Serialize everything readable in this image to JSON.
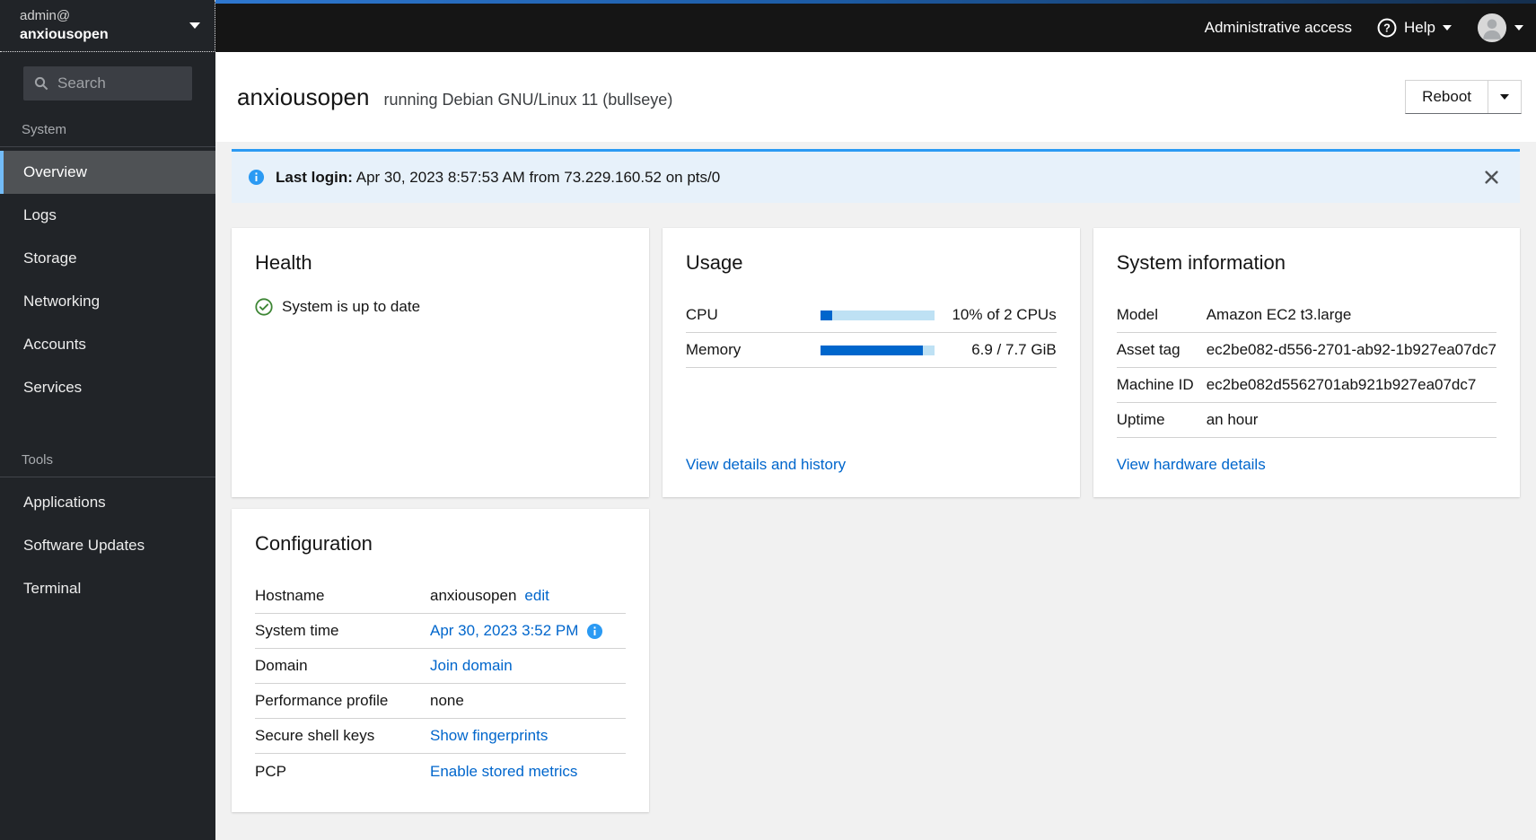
{
  "masthead": {
    "admin_access_label": "Administrative access",
    "help_label": "Help"
  },
  "sidebar": {
    "user": "admin@",
    "host": "anxiousopen",
    "search_placeholder": "Search",
    "sections": [
      {
        "label": "System",
        "items": [
          {
            "label": "Overview",
            "selected": true
          },
          {
            "label": "Logs"
          },
          {
            "label": "Storage"
          },
          {
            "label": "Networking"
          },
          {
            "label": "Accounts"
          },
          {
            "label": "Services"
          }
        ]
      },
      {
        "label": "Tools",
        "items": [
          {
            "label": "Applications"
          },
          {
            "label": "Software Updates"
          },
          {
            "label": "Terminal"
          }
        ]
      }
    ]
  },
  "header": {
    "hostname": "anxiousopen",
    "os": "running Debian GNU/Linux 11 (bullseye)",
    "reboot_label": "Reboot"
  },
  "alert": {
    "title": "Last login:",
    "message": "Apr 30, 2023 8:57:53 AM from 73.229.160.52 on pts/0"
  },
  "cards": {
    "health": {
      "title": "Health",
      "status": "System is up to date"
    },
    "usage": {
      "title": "Usage",
      "rows": [
        {
          "label": "CPU",
          "value": "10% of 2 CPUs",
          "percent": 10
        },
        {
          "label": "Memory",
          "value": "6.9 / 7.7 GiB",
          "percent": 90
        }
      ],
      "link": "View details and history"
    },
    "system_information": {
      "title": "System information",
      "rows": [
        {
          "label": "Model",
          "value": "Amazon EC2 t3.large"
        },
        {
          "label": "Asset tag",
          "value": "ec2be082-d556-2701-ab92-1b927ea07dc7"
        },
        {
          "label": "Machine ID",
          "value": "ec2be082d5562701ab921b927ea07dc7"
        },
        {
          "label": "Uptime",
          "value": "an hour"
        }
      ],
      "link": "View hardware details"
    },
    "configuration": {
      "title": "Configuration",
      "rows": [
        {
          "label": "Hostname",
          "text": "anxiousopen",
          "link": "edit"
        },
        {
          "label": "System time",
          "link": "Apr 30, 2023 3:52 PM",
          "info": true
        },
        {
          "label": "Domain",
          "link": "Join domain"
        },
        {
          "label": "Performance profile",
          "text": "none"
        },
        {
          "label": "Secure shell keys",
          "link": "Show fingerprints"
        },
        {
          "label": "PCP",
          "link": "Enable stored metrics"
        }
      ]
    }
  },
  "colors": {
    "accent_link": "#0066cc",
    "info_blue": "#2b9af3",
    "success_green": "#3e8635",
    "nav_selected_border": "#73bcf7",
    "masthead_bg": "#151515",
    "sidebar_bg": "#212428",
    "alert_bg": "#e7f1fa",
    "progress_track": "#bee1f4"
  }
}
